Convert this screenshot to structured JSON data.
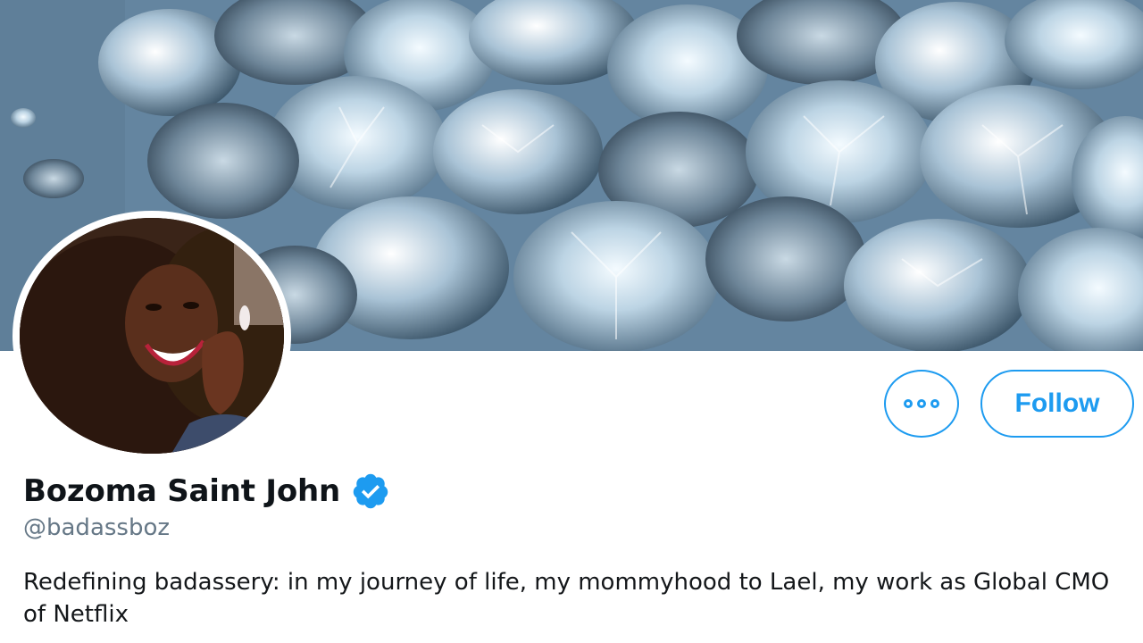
{
  "profile": {
    "display_name": "Bozoma Saint John",
    "handle": "@badassboz",
    "bio": "Redefining badassery: in my journey of life, my mommyhood to Lael, my work as Global CMO of Netflix",
    "verified": true
  },
  "actions": {
    "follow_label": "Follow"
  },
  "icons": {
    "more": "more-options-icon",
    "verified": "verified-badge-icon"
  },
  "colors": {
    "accent": "#1d9bf0",
    "handle_text": "#657786",
    "name_text": "#0f1419"
  }
}
